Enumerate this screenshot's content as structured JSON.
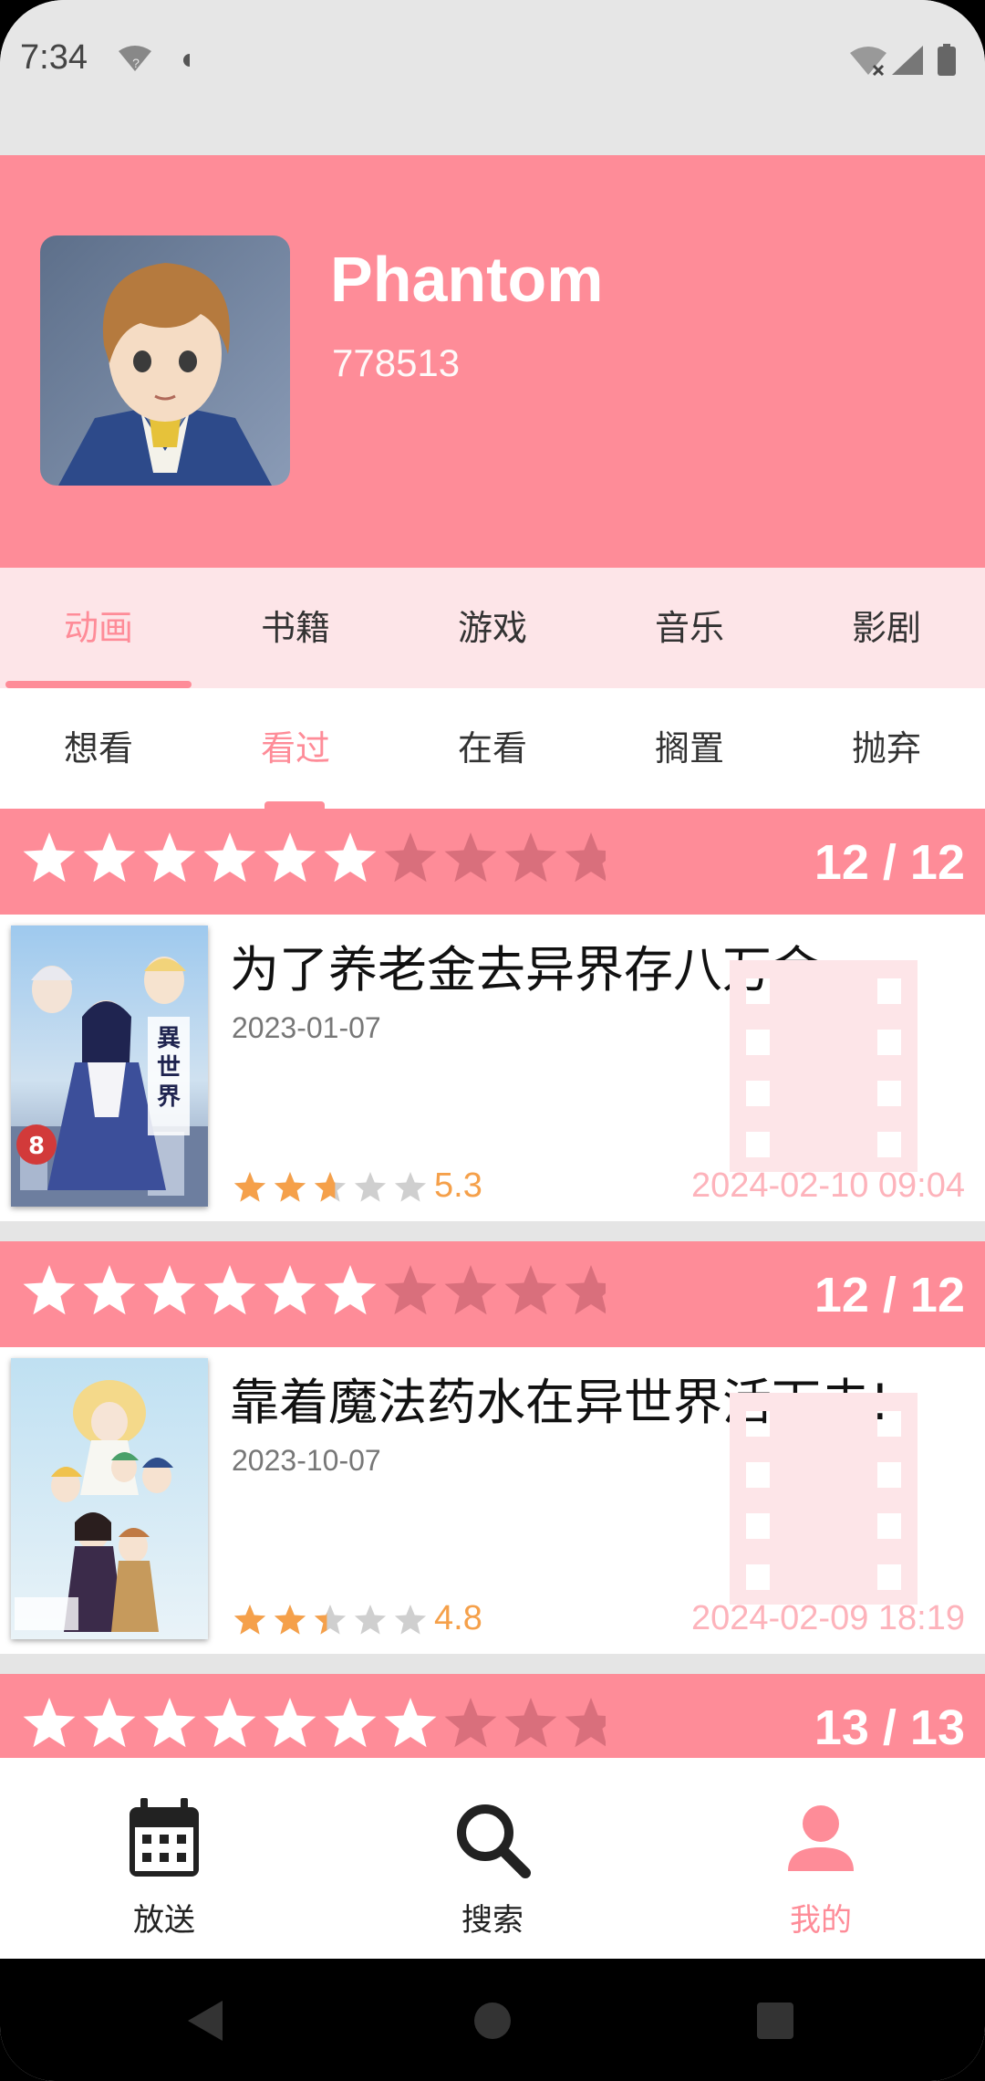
{
  "status_bar": {
    "time": "7:34",
    "left_icons": [
      "wifi-unknown-icon",
      "dot-icon"
    ],
    "right_icons": [
      "wifi-off-icon",
      "signal-icon",
      "battery-icon"
    ]
  },
  "profile": {
    "name": "Phantom",
    "user_id": "778513"
  },
  "category_tabs": [
    {
      "label": "动画",
      "active": true
    },
    {
      "label": "书籍",
      "active": false
    },
    {
      "label": "游戏",
      "active": false
    },
    {
      "label": "音乐",
      "active": false
    },
    {
      "label": "影剧",
      "active": false
    }
  ],
  "status_tabs": [
    {
      "label": "想看",
      "active": false
    },
    {
      "label": "看过",
      "active": true
    },
    {
      "label": "在看",
      "active": false
    },
    {
      "label": "搁置",
      "active": false
    },
    {
      "label": "抛弃",
      "active": false
    }
  ],
  "entries": [
    {
      "user_rating": 6,
      "rating_max": 10,
      "progress": "12 / 12",
      "title": "为了养老金去异界存八万金",
      "air_date": "2023-01-07",
      "score": "5.3",
      "score_stars": 2.65,
      "watch_date": "2024-02-10  09:04"
    },
    {
      "user_rating": 6,
      "rating_max": 10,
      "progress": "12 / 12",
      "title": "靠着魔法药水在异世界活下去!",
      "air_date": "2023-10-07",
      "score": "4.8",
      "score_stars": 2.4,
      "watch_date": "2024-02-09  18:19"
    },
    {
      "user_rating": 7,
      "rating_max": 10,
      "progress": "13 / 13"
    }
  ],
  "bottom_nav": [
    {
      "label": "放送",
      "icon": "calendar-icon",
      "active": false
    },
    {
      "label": "搜索",
      "icon": "search-icon",
      "active": false
    },
    {
      "label": "我的",
      "icon": "person-icon",
      "active": true
    }
  ],
  "colors": {
    "accent": "#fe8c98",
    "accent_light": "#fde5e8",
    "star_gold": "#f5a04a",
    "watch_date": "#fdb3bb"
  }
}
